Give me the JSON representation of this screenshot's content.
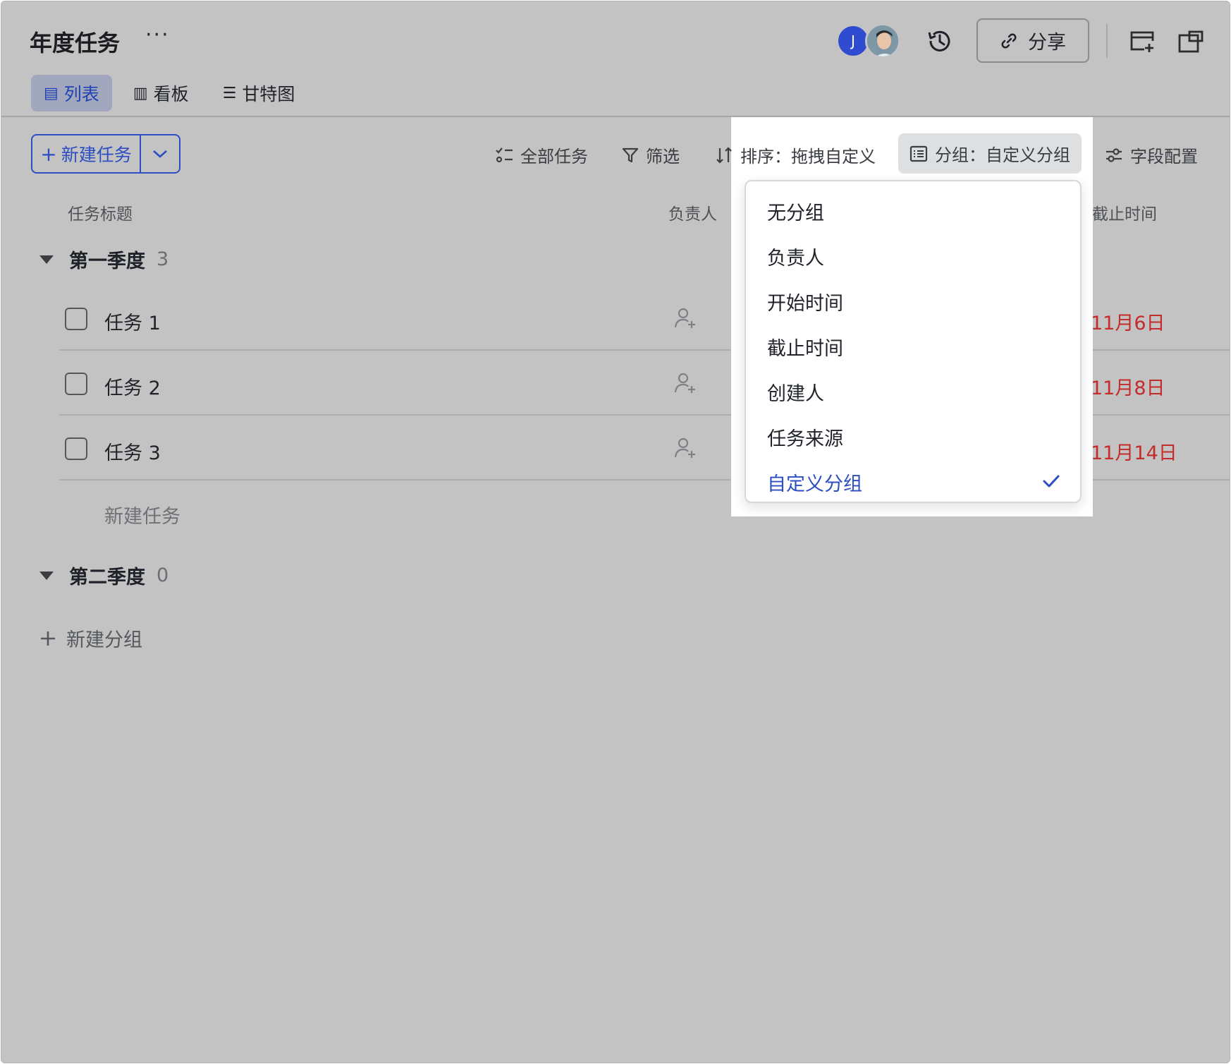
{
  "header": {
    "title": "年度任务",
    "more_label": "···",
    "avatar_initial": "J",
    "share_label": "分享"
  },
  "tabs": [
    {
      "label": "列表",
      "icon": "list-icon",
      "active": true
    },
    {
      "label": "看板",
      "icon": "kanban-icon",
      "active": false
    },
    {
      "label": "甘特图",
      "icon": "gantt-icon",
      "active": false
    }
  ],
  "toolbar": {
    "new_task_label": "新建任务",
    "all_tasks_label": "全部任务",
    "filter_label": "筛选",
    "sort_label": "排序：拖拽自定义",
    "group_label": "分组：自定义分组",
    "fields_label": "字段配置"
  },
  "columns": {
    "title": "任务标题",
    "assignee": "负责人",
    "due": "截止时间"
  },
  "groups": [
    {
      "name": "第一季度",
      "count": "3",
      "tasks": [
        {
          "name": "任务 1",
          "due": "11月6日"
        },
        {
          "name": "任务 2",
          "due": "11月8日"
        },
        {
          "name": "任务 3",
          "due": "11月14日"
        }
      ],
      "add_task_label": "新建任务"
    },
    {
      "name": "第二季度",
      "count": "0"
    }
  ],
  "add_group_label": "新建分组",
  "group_menu": {
    "items": [
      "无分组",
      "负责人",
      "开始时间",
      "截止时间",
      "创建人",
      "任务来源",
      "自定义分组"
    ],
    "selected": "自定义分组"
  },
  "colors": {
    "accent": "#2c4ec2",
    "overdue": "#c42b2b",
    "dim_background": "#c3c3c3"
  }
}
